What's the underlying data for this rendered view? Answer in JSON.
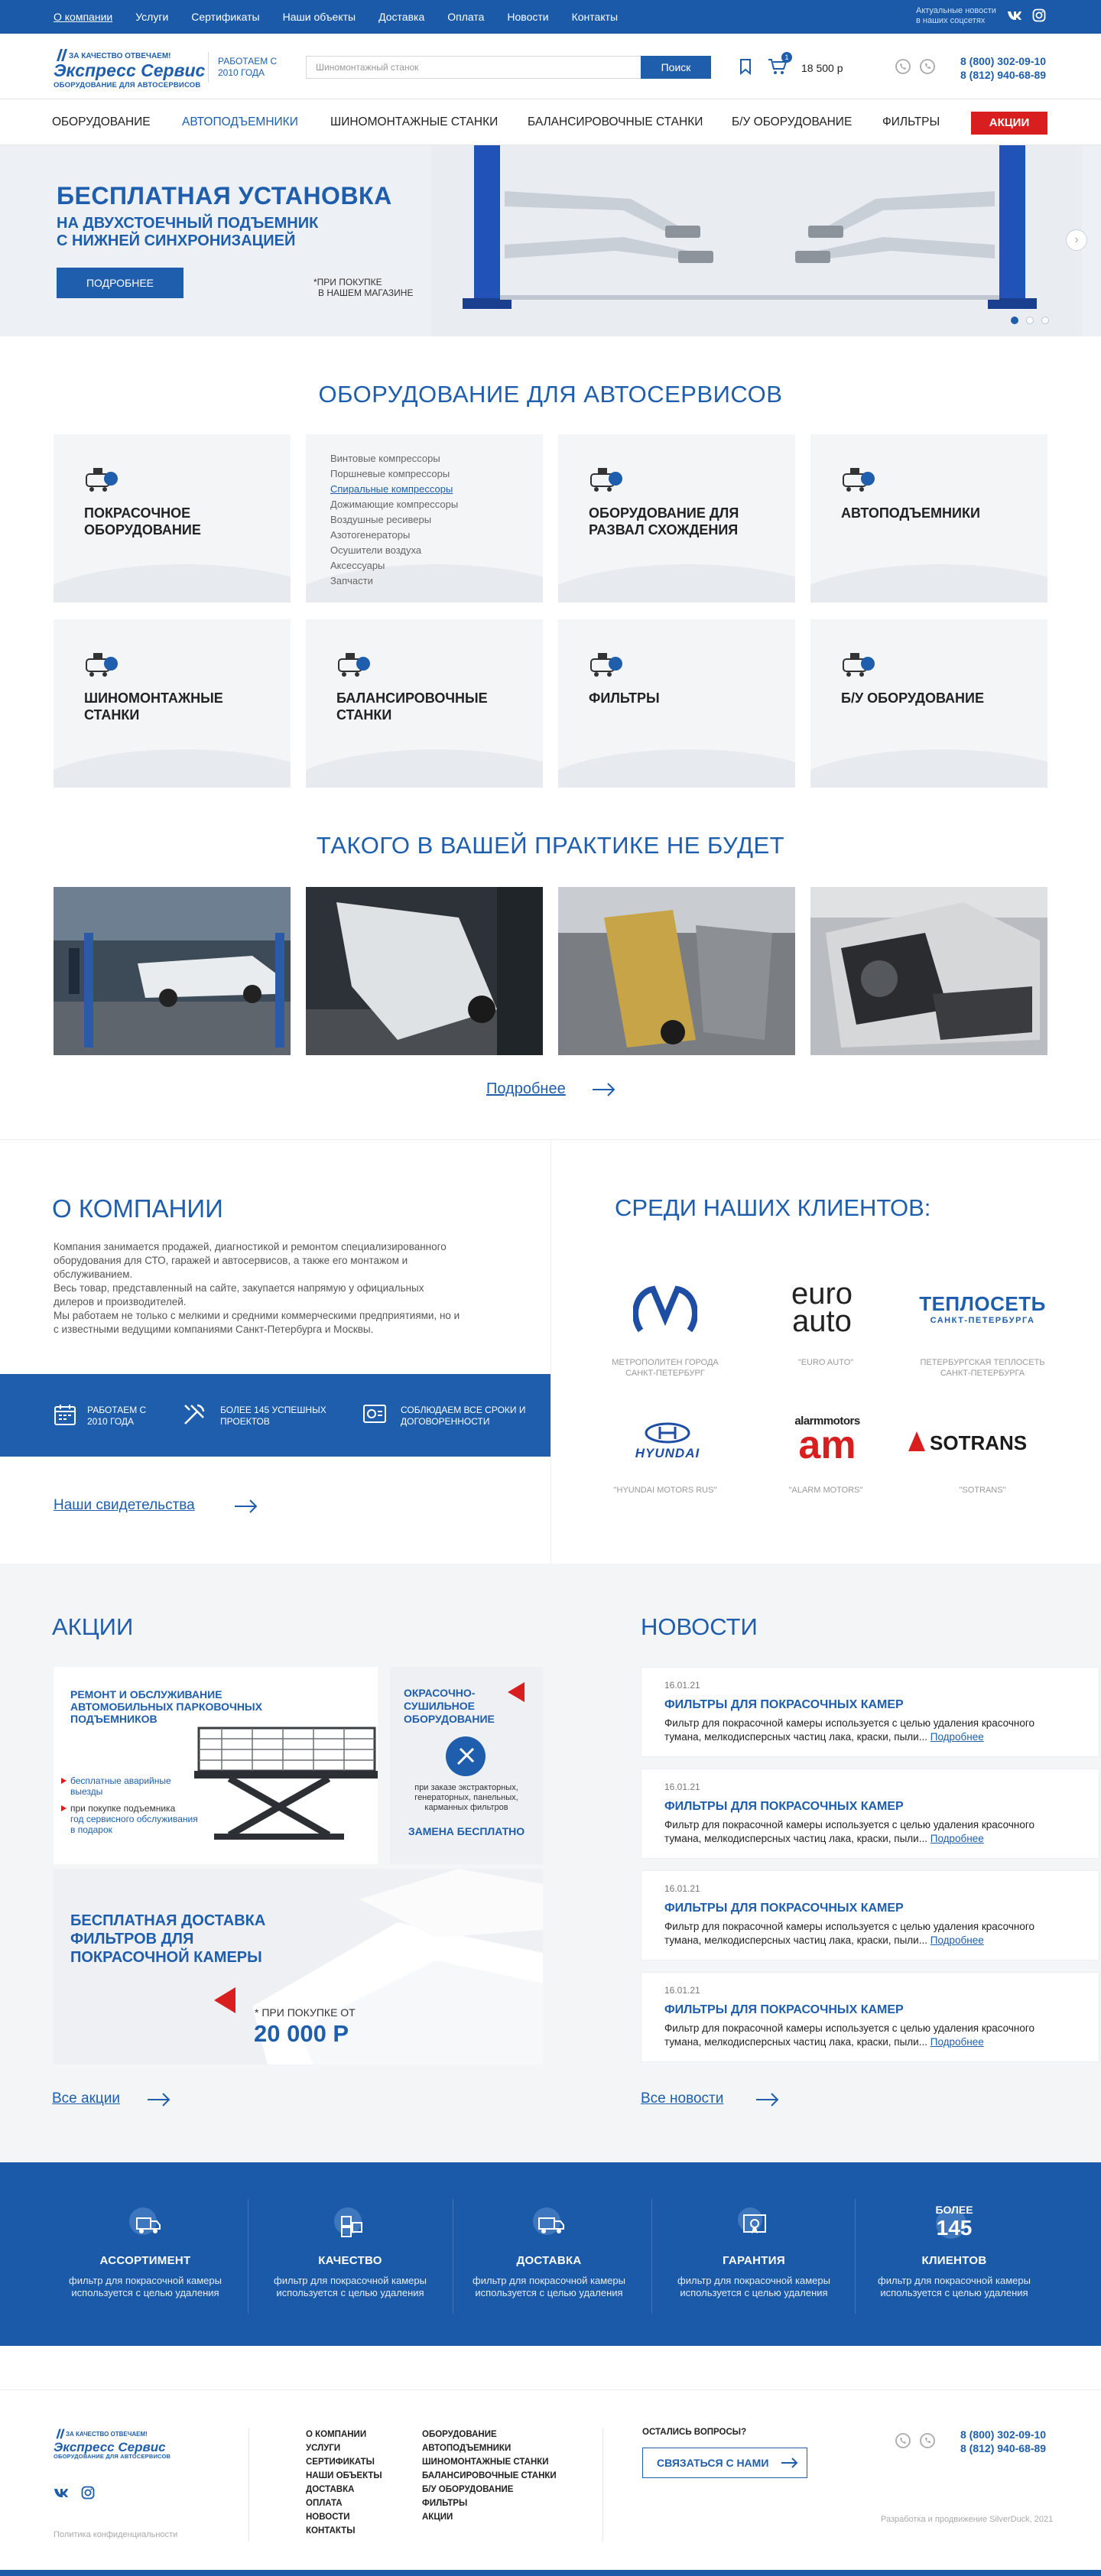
{
  "topbar": {
    "nav": [
      "О компании",
      "Услуги",
      "Сертификаты",
      "Наши объекты",
      "Доставка",
      "Оплата",
      "Новости",
      "Контакты"
    ],
    "news_text": "Актуальные новости в наших соцсетях"
  },
  "header": {
    "logo_slogan": "ЗА КАЧЕСТВО ОТВЕЧАЕМ!",
    "logo_name": "Экспресс Сервис",
    "logo_sub": "ОБОРУДОВАНИЕ ДЛЯ АВТОСЕРВИСОВ",
    "since": "РАБОТАЕМ С 2010 ГОДА",
    "search_placeholder": "Шиномонтажный станок",
    "search_button": "Поиск",
    "cart_count": "1",
    "cart_sum": "18 500 р",
    "phone1": "8 (800) 302-09-10",
    "phone2": "8 (812) 940-68-89"
  },
  "mainnav": {
    "items": [
      "ОБОРУДОВАНИЕ",
      "АВТОПОДЪЕМНИКИ",
      "ШИНОМОНТАЖНЫЕ СТАНКИ",
      "БАЛАНСИРОВОЧНЫЕ СТАНКИ",
      "Б/У ОБОРУДОВАНИЕ",
      "ФИЛЬТРЫ"
    ],
    "promo": "АКЦИИ"
  },
  "hero": {
    "title": "БЕСПЛАТНАЯ УСТАНОВКА",
    "subtitle1": "НА ДВУХСТОЕЧНЫЙ ПОДЪЕМНИК",
    "subtitle2": "С НИЖНЕЙ СИНХРОНИЗАЦИЕЙ",
    "button": "ПОДРОБНЕЕ",
    "note1": "*ПРИ ПОКУПКЕ",
    "note2": "В НАШЕМ МАГАЗИНЕ"
  },
  "equipment": {
    "title": "ОБОРУДОВАНИЕ ДЛЯ АВТОСЕРВИСОВ",
    "card1": "ПОКРАСОЧНОЕ ОБОРУДОВАНИЕ",
    "submenu": [
      "Винтовые компрессоры",
      "Поршневые компрессоры",
      "Спиральные компрессоры",
      "Дожимающие компрессоры",
      "Воздушные ресиверы",
      "Азотогенераторы",
      "Осушители воздуха",
      "Аксессуары",
      "Запчасти"
    ],
    "card3": "ОБОРУДОВАНИЕ ДЛЯ РАЗВАЛ СХОЖДЕНИЯ",
    "card4": "АВТОПОДЪЕМНИКИ",
    "card5": "ШИНОМОНТАЖНЫЕ СТАНКИ",
    "card6": "БАЛАНСИРОВОЧНЫЕ СТАНКИ",
    "card7": "ФИЛЬТРЫ",
    "card8": "Б/У ОБОРУДОВАНИЕ"
  },
  "practice": {
    "title": "ТАКОГО В ВАШЕЙ ПРАКТИКЕ НЕ БУДЕТ",
    "more": "Подробнее"
  },
  "about": {
    "title": "О КОМПАНИИ",
    "p1": "Компания занимается продажей, диагностикой и ремонтом специализированного оборудования для СТО, гаражей и автосервисов, а также его монтажом и обслуживанием.",
    "p2": "Весь товар, представленный на сайте, закупается напрямую у официальных дилеров и производителей.",
    "p3": "Мы работаем не только с мелкими и средними коммерческими предприятиями, но и с известными ведущими компаниями Санкт-Петербурга и Москвы.",
    "stat1": "РАБОТАЕМ С 2010 ГОДА",
    "stat2": "БОЛЕЕ 145 УСПЕШНЫХ ПРОЕКТОВ",
    "stat3": "СОБЛЮДАЕМ ВСЕ СРОКИ И ДОГОВОРЕННОСТИ",
    "certs": "Наши свидетельства"
  },
  "clients": {
    "title": "СРЕДИ НАШИХ КЛИЕНТОВ:",
    "items": [
      "МЕТРОПОЛИТЕН ГОРОДА САНКТ-ПЕТЕРБУРГ",
      "\"EURO AUTO\"",
      "ПЕТЕРБУРГСКАЯ ТЕПЛОСЕТЬ САНКТ-ПЕТЕРБУРГА",
      "\"HYUNDAI MOTORS RUS\"",
      "\"ALARM MOTORS\"",
      "\"SOTRANS\""
    ],
    "logo_euro1": "euro",
    "logo_euro2": "auto",
    "logo_teplo1": "ТЕПЛОСЕТЬ",
    "logo_teplo2": "САНКТ-ПЕТЕРБУРГА",
    "logo_hyundai": "HYUNDAI",
    "logo_alarm": "alarmmotors",
    "logo_am": "am",
    "logo_sotrans": "SOTRANS"
  },
  "promos": {
    "title": "АКЦИИ",
    "p1_title": "РЕМОНТ И ОБСЛУЖИВАНИЕ АВТОМОБИЛЬНЫХ ПАРКОВОЧНЫХ ПОДЪЕМНИКОВ",
    "p1_b1": "бесплатные аварийные выезды",
    "p1_b2": "при покупке подъемника",
    "p1_b2_hl": "год сервисного обслуживания в подарок",
    "p2_title": "ОКРАСОЧНО-СУШИЛЬНОЕ ОБОРУДОВАНИЕ",
    "p2_text": "при заказе экстракторных, генераторных, панельных, карманных фильтров",
    "p2_bottom": "ЗАМЕНА БЕСПЛАТНО",
    "p3_title": "БЕСПЛАТНАЯ ДОСТАВКА ФИЛЬТРОВ ДЛЯ ПОКРАСОЧНОЙ КАМЕРЫ",
    "p3_note": "* ПРИ ПОКУПКЕ ОТ",
    "p3_sum": "20 000 Р",
    "all": "Все акции"
  },
  "news": {
    "title": "НОВОСТИ",
    "items": [
      {
        "date": "16.01.21",
        "title": "ФИЛЬТРЫ ДЛЯ ПОКРАСОЧНЫХ КАМЕР",
        "text": "Фильтр для покрасочной камеры используется с целью удаления красочного тумана, мелкодисперсных частиц лака, краски, пыли..."
      },
      {
        "date": "16.01.21",
        "title": "ФИЛЬТРЫ ДЛЯ ПОКРАСОЧНЫХ КАМЕР",
        "text": "Фильтр для покрасочной камеры используется с целью удаления красочного тумана, мелкодисперсных частиц лака, краски, пыли..."
      },
      {
        "date": "16.01.21",
        "title": "ФИЛЬТРЫ ДЛЯ ПОКРАСОЧНЫХ КАМЕР",
        "text": "Фильтр для покрасочной камеры используется с целью удаления красочного тумана, мелкодисперсных частиц лака, краски, пыли..."
      },
      {
        "date": "16.01.21",
        "title": "ФИЛЬТРЫ ДЛЯ ПОКРАСОЧНЫХ КАМЕР",
        "text": "Фильтр для покрасочной камеры используется с целью удаления красочного тумана, мелкодисперсных частиц лака, краски, пыли..."
      }
    ],
    "more": "Подробнее",
    "all": "Все новости"
  },
  "features": {
    "items": [
      {
        "title": "АССОРТИМЕНТ",
        "text": "фильтр для покрасочной камеры используется с целью удаления"
      },
      {
        "title": "КАЧЕСТВО",
        "text": "фильтр для покрасочной камеры используется с целью удаления"
      },
      {
        "title": "ДОСТАВКА",
        "text": "фильтр для покрасочной камеры используется с целью удаления"
      },
      {
        "title": "ГАРАНТИЯ",
        "text": "фильтр для покрасочной камеры используется с целью удаления"
      },
      {
        "title": "КЛИЕНТОВ",
        "text": "фильтр для покрасочной камеры используется с целью удаления"
      }
    ],
    "clients_pre": "БОЛЕЕ",
    "clients_num": "145"
  },
  "footer": {
    "col1": [
      "О КОМПАНИИ",
      "УСЛУГИ",
      "СЕРТИФИКАТЫ",
      "НАШИ ОБЪЕКТЫ",
      "ДОСТАВКА",
      "ОПЛАТА",
      "НОВОСТИ",
      "КОНТАКТЫ"
    ],
    "col2": [
      "ОБОРУДОВАНИЕ",
      "АВТОПОДЪЕМНИКИ",
      "ШИНОМОНТАЖНЫЕ СТАНКИ",
      "БАЛАНСИРОВОЧНЫЕ СТАНКИ",
      "Б/У ОБОРУДОВАНИЕ",
      "ФИЛЬТРЫ",
      "АКЦИИ"
    ],
    "question": "ОСТАЛИСЬ ВОПРОСЫ?",
    "contact_btn": "СВЯЗАТЬСЯ С НАМИ",
    "privacy": "Политика конфиденциальности",
    "dev": "Разработка и продвижение SilverDuck, 2021"
  },
  "colors": {
    "brand": "#1e5eac",
    "accent_red": "#d81e1e",
    "topbar": "#1a5aa8"
  }
}
